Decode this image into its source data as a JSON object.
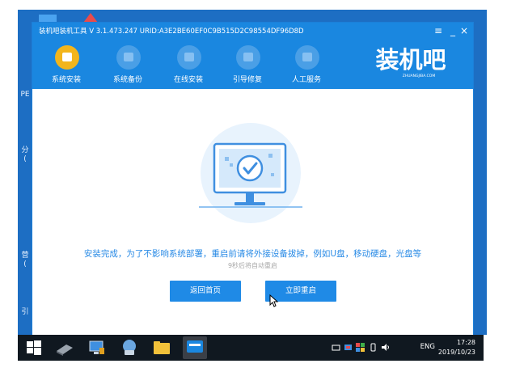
{
  "window": {
    "title": "装机吧装机工具 V 3.1.473.247 URID:A3E2BE60EF0C9B515D2C98554DF96D8D",
    "controls": {
      "menu": "≡",
      "minimize": "_",
      "close": "×"
    }
  },
  "nav": {
    "items": [
      {
        "label": "系统安装",
        "icon": "system-install-icon",
        "active": true
      },
      {
        "label": "系统备份",
        "icon": "system-backup-icon",
        "active": false
      },
      {
        "label": "在线安装",
        "icon": "online-install-icon",
        "active": false
      },
      {
        "label": "引导修复",
        "icon": "boot-repair-icon",
        "active": false
      },
      {
        "label": "人工服务",
        "icon": "customer-service-icon",
        "active": false
      }
    ]
  },
  "brand": {
    "name": "装机吧",
    "url": "ZHUANGJIBA.COM"
  },
  "content": {
    "message": "安装完成，为了不影响系统部署，重启前请将外接设备拔掉，例如U盘，移动硬盘，光盘等",
    "countdown": "9秒后将自动重启",
    "buttons": {
      "home": "返回首页",
      "restart": "立即重启"
    }
  },
  "desktop": {
    "labels": [
      "PE",
      "分",
      "(",
      "营",
      "(",
      "引"
    ]
  },
  "taskbar": {
    "language": "ENG",
    "time": "17:28",
    "date": "2019/10/23"
  },
  "colors": {
    "accent": "#1a87e0",
    "active_nav": "#f2b51c",
    "message_text": "#2a8be6",
    "desktop": "#1d6ec3",
    "taskbar": "#101820"
  }
}
